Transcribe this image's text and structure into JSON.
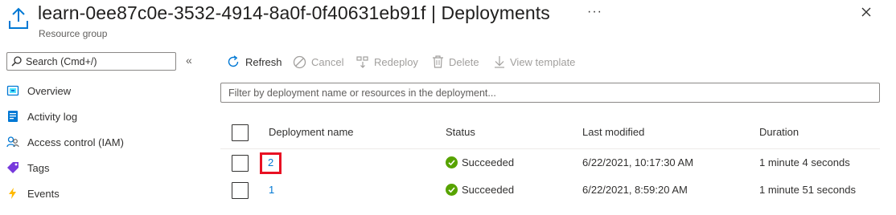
{
  "header": {
    "title": "learn-0ee87c0e-3532-4914-8a0f-0f40631eb91f | Deployments",
    "subtitle": "Resource group",
    "more_label": "···",
    "icon": "upload-arrow-icon",
    "close_icon": "close-icon"
  },
  "sidebar": {
    "search_placeholder": "Search (Cmd+/)",
    "collapse_label": "«",
    "items": [
      {
        "label": "Overview",
        "icon": "overview-icon"
      },
      {
        "label": "Activity log",
        "icon": "activity-log-icon"
      },
      {
        "label": "Access control (IAM)",
        "icon": "people-icon"
      },
      {
        "label": "Tags",
        "icon": "tag-icon"
      },
      {
        "label": "Events",
        "icon": "lightning-icon"
      }
    ]
  },
  "toolbar": {
    "refresh": "Refresh",
    "cancel": "Cancel",
    "redeploy": "Redeploy",
    "delete": "Delete",
    "view_template": "View template"
  },
  "filter": {
    "placeholder": "Filter by deployment name or resources in the deployment..."
  },
  "table": {
    "columns": [
      "Deployment name",
      "Status",
      "Last modified",
      "Duration"
    ],
    "rows": [
      {
        "name": "2",
        "status": "Succeeded",
        "last_modified": "6/22/2021, 10:17:30 AM",
        "duration": "1 minute 4 seconds",
        "highlighted": true
      },
      {
        "name": "1",
        "status": "Succeeded",
        "last_modified": "6/22/2021, 8:59:20 AM",
        "duration": "1 minute 51 seconds",
        "highlighted": false
      }
    ]
  },
  "colors": {
    "accent": "#0078d4",
    "success": "#57a300",
    "highlight": "#e81123"
  }
}
